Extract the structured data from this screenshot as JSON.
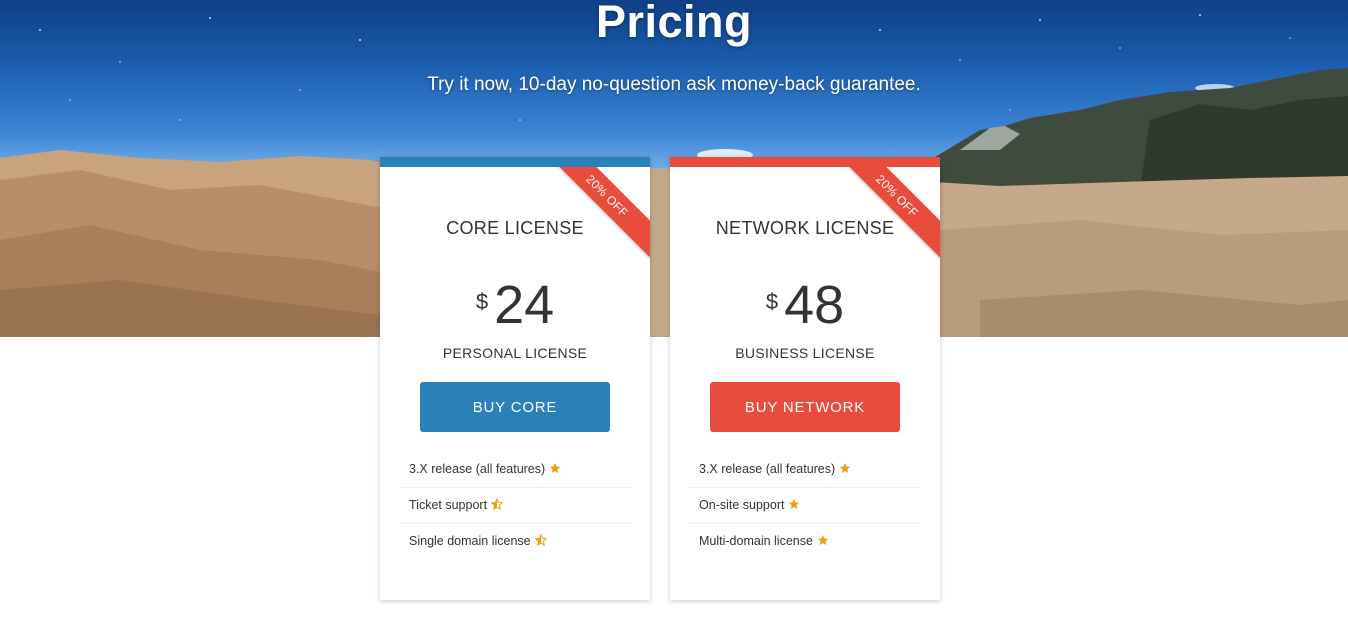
{
  "hero": {
    "title": "Pricing",
    "subtitle": "Try it now, 10-day no-question ask money-back guarantee."
  },
  "colors": {
    "core_accent": "#2a80b9",
    "network_accent": "#e74c3c",
    "star": "#f39c12"
  },
  "plans": [
    {
      "title": "CORE LICENSE",
      "ribbon": "20% OFF",
      "currency": "$",
      "price": "24",
      "kind": "PERSONAL LICENSE",
      "button": "BUY CORE",
      "features": [
        {
          "label": "3.X release (all features)",
          "icon": "star-full-icon"
        },
        {
          "label": "Ticket support",
          "icon": "star-half-icon"
        },
        {
          "label": "Single domain license",
          "icon": "star-half-icon"
        }
      ]
    },
    {
      "title": "NETWORK LICENSE",
      "ribbon": "20% OFF",
      "currency": "$",
      "price": "48",
      "kind": "BUSINESS LICENSE",
      "button": "BUY NETWORK",
      "features": [
        {
          "label": "3.X release (all features)",
          "icon": "star-full-icon"
        },
        {
          "label": "On-site support",
          "icon": "star-full-icon"
        },
        {
          "label": "Multi-domain license",
          "icon": "star-full-icon"
        }
      ]
    }
  ]
}
